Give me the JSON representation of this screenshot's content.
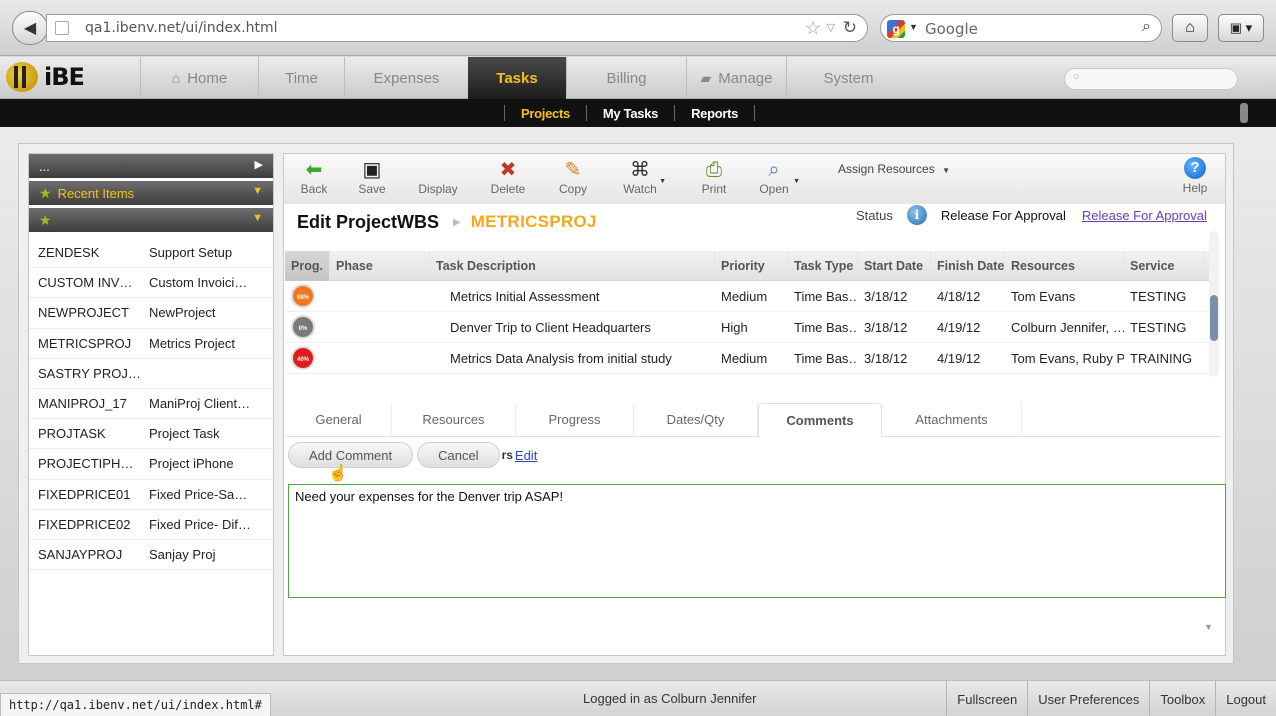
{
  "browser": {
    "url": "qa1.ibenv.net/ui/index.html",
    "search_placeholder": "Google",
    "icons": {
      "back": "back-arrow-icon",
      "reload": "reload-icon",
      "home": "home-icon",
      "bookmarks": "bookmarks-icon"
    }
  },
  "app": {
    "logo": "iBE",
    "nav": [
      {
        "label": "Home",
        "icon": "house-icon"
      },
      {
        "label": "Time"
      },
      {
        "label": "Expenses"
      },
      {
        "label": "Tasks",
        "active": true
      },
      {
        "label": "Billing"
      },
      {
        "label": "Manage",
        "icon": "briefcase-icon"
      },
      {
        "label": "System"
      }
    ],
    "subnav": [
      {
        "label": "Projects",
        "active": true
      },
      {
        "label": "My Tasks"
      },
      {
        "label": "Reports"
      }
    ]
  },
  "sidebar": {
    "headers": [
      {
        "label": "..."
      },
      {
        "label": "Recent Items"
      },
      {
        "label": ""
      }
    ],
    "items": [
      {
        "code": "ZENDESK",
        "name": "Support Setup"
      },
      {
        "code": "CUSTOM INV…",
        "name": "Custom Invoici…"
      },
      {
        "code": "NEWPROJECT",
        "name": "NewProject"
      },
      {
        "code": "METRICSPROJ",
        "name": "Metrics Project"
      },
      {
        "code": "SASTRY PROJ…",
        "name": ""
      },
      {
        "code": "MANIPROJ_17",
        "name": "ManiProj Client…"
      },
      {
        "code": "PROJTASK",
        "name": "Project Task"
      },
      {
        "code": "PROJECTIPH…",
        "name": "Project iPhone"
      },
      {
        "code": "FIXEDPRICE01",
        "name": "Fixed Price-Sa…"
      },
      {
        "code": "FIXEDPRICE02",
        "name": "Fixed Price- Dif…"
      },
      {
        "code": "SANJAYPROJ",
        "name": "Sanjay Proj"
      }
    ]
  },
  "toolbar": {
    "back": "Back",
    "save": "Save",
    "display": "Display",
    "delete": "Delete",
    "copy": "Copy",
    "watch": "Watch",
    "print": "Print",
    "open": "Open",
    "assign_resources": "Assign Resources",
    "help": "Help"
  },
  "page": {
    "title": "Edit ProjectWBS",
    "project_code": "METRICSPROJ",
    "status_label": "Status",
    "status_value": "Release For Approval",
    "status_link": "Release For Approval"
  },
  "grid": {
    "columns": [
      "Prog.",
      "Phase",
      "Task Description",
      "Priority",
      "Task Type",
      "Start Date",
      "Finish Date",
      "Resources",
      "Service"
    ],
    "rows": [
      {
        "progress": "68%",
        "progress_color": "#f0781e",
        "phase": "",
        "description": "Metrics Initial Assessment",
        "priority": "Medium",
        "task_type": "Time Bas…",
        "start": "3/18/12",
        "finish": "4/18/12",
        "resources": "Tom Evans",
        "service": "TESTING"
      },
      {
        "progress": "0%",
        "progress_color": "#7a7a7a",
        "phase": "",
        "description": "Denver Trip to Client Headquarters",
        "priority": "High",
        "task_type": "Time Bas…",
        "start": "3/18/12",
        "finish": "4/19/12",
        "resources": "Colburn Jennifer, …",
        "service": "TESTING"
      },
      {
        "progress": "40%",
        "progress_color": "#e21c1c",
        "phase": "",
        "description": "Metrics Data Analysis from initial study",
        "priority": "Medium",
        "task_type": "Time Bas…",
        "start": "3/18/12",
        "finish": "4/19/12",
        "resources": "Tom Evans, Ruby P",
        "service": "TRAINING"
      }
    ]
  },
  "tabs": [
    {
      "label": "General"
    },
    {
      "label": "Resources"
    },
    {
      "label": "Progress"
    },
    {
      "label": "Dates/Qty"
    },
    {
      "label": "Comments",
      "active": true
    },
    {
      "label": "Attachments"
    }
  ],
  "comments": {
    "add_label": "Add Comment",
    "cancel_label": "Cancel",
    "edit_prefix": "rs",
    "edit_link": "Edit",
    "text": "Need your expenses for the Denver trip ASAP!"
  },
  "statusbar": {
    "hover_url": "http://qa1.ibenv.net/ui/index.html#",
    "logged_in": "Logged in as Colburn Jennifer",
    "links": [
      "Fullscreen",
      "User Preferences",
      "Toolbox",
      "Logout"
    ]
  }
}
